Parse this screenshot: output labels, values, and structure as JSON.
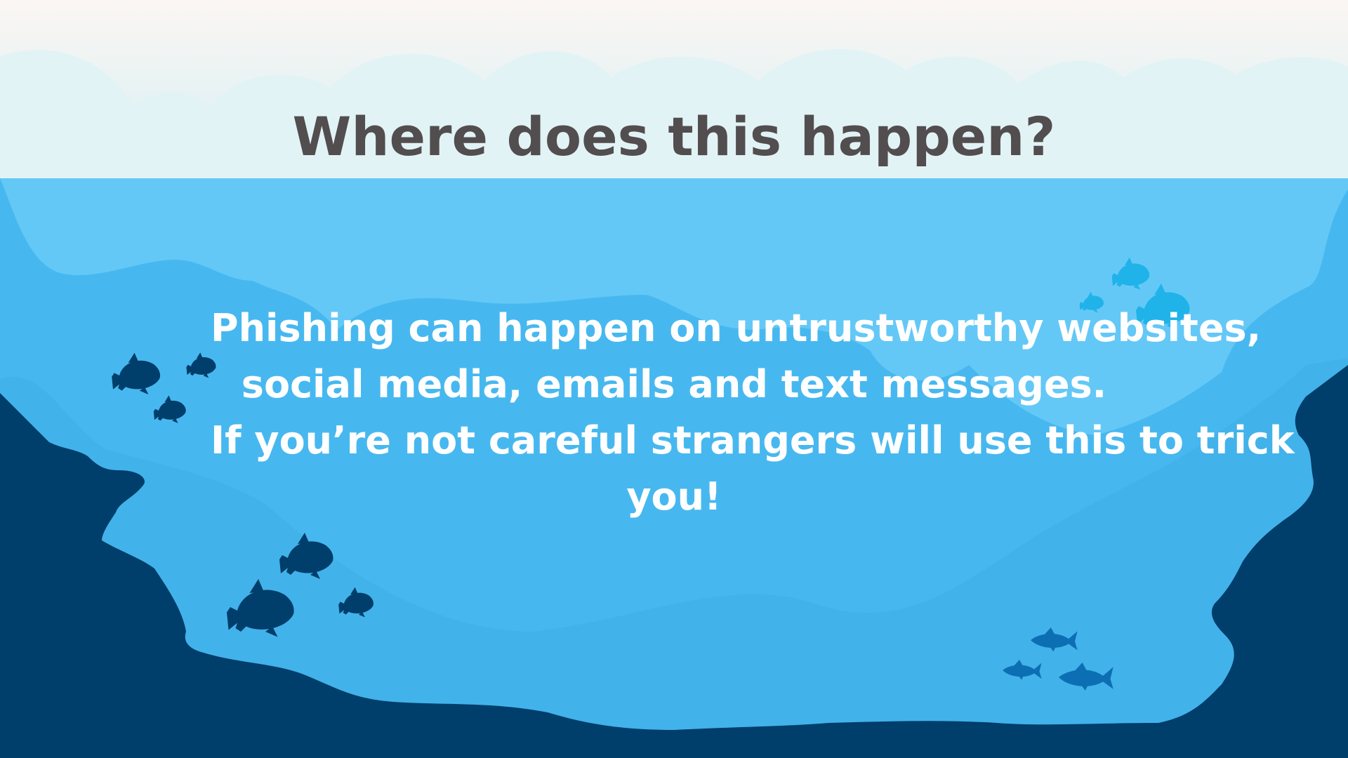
{
  "slide": {
    "title": "Where does this happen?",
    "body_lines": [
      "Phishing can happen on untrustworthy websites,",
      "social media, emails and text messages.",
      "If you’re not careful strangers will use this to trick",
      "you!"
    ]
  },
  "colors": {
    "sky_top": "#fbf6f3",
    "sky_bottom": "#d6eff4",
    "water_light": "#64c8f6",
    "water_mid": "#47b8ef",
    "water_deep": "#3ba8e1",
    "rock_dark": "#003e6b",
    "title_text": "#524d4f",
    "body_text": "#ffffff"
  },
  "decorations": {
    "fish_icons": [
      "dark-fish-school-left",
      "dark-fish-school-bottom-left",
      "light-fish-school-top-right",
      "blue-fish-school-bottom-right"
    ]
  }
}
